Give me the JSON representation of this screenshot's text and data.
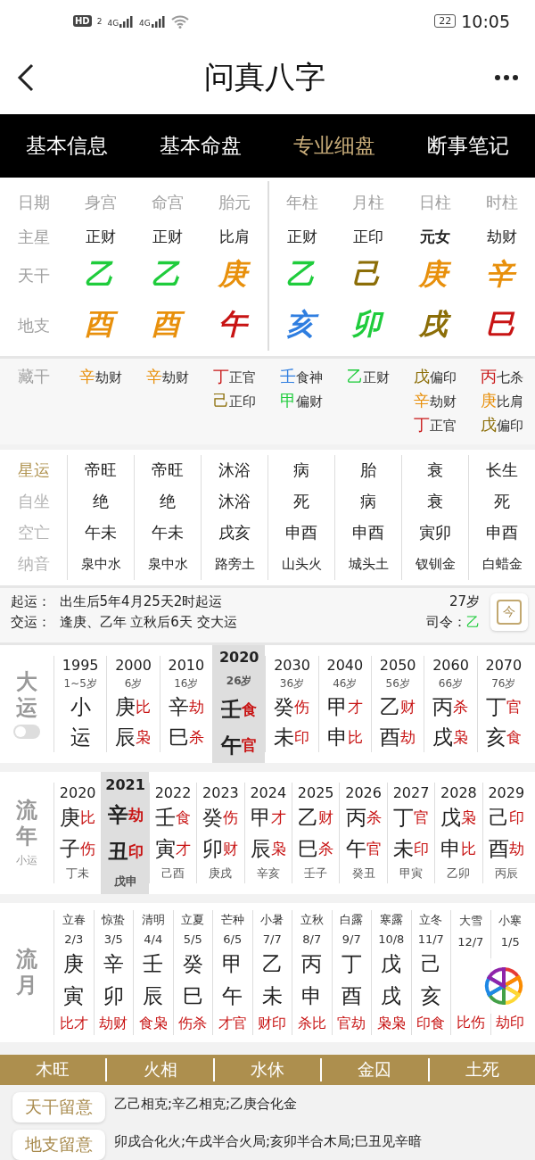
{
  "status_bar": {
    "badge": "HD",
    "sim": "2",
    "networks": [
      "4G",
      "4G"
    ],
    "battery": "22",
    "time": "10:05"
  },
  "header": {
    "title": "问真八字"
  },
  "tabs": [
    {
      "label": "基本信息",
      "selected": false
    },
    {
      "label": "基本命盘",
      "selected": false
    },
    {
      "label": "专业细盘",
      "selected": true
    },
    {
      "label": "断事笔记",
      "selected": false
    }
  ],
  "chart": {
    "row_labels": [
      "日期",
      "主星",
      "天干",
      "地支"
    ],
    "columns": [
      {
        "header": "身宫",
        "star": "正财",
        "star_bold": false,
        "stem": {
          "char": "乙",
          "color": "#1fcc3c"
        },
        "branch": {
          "char": "酉",
          "color": "#e8900c"
        }
      },
      {
        "header": "命宫",
        "star": "正财",
        "star_bold": false,
        "stem": {
          "char": "乙",
          "color": "#1fcc3c"
        },
        "branch": {
          "char": "酉",
          "color": "#e8900c"
        }
      },
      {
        "header": "胎元",
        "star": "比肩",
        "star_bold": false,
        "stem": {
          "char": "庚",
          "color": "#e8900c"
        },
        "branch": {
          "char": "午",
          "color": "#c81414"
        }
      },
      {
        "header": "年柱",
        "star": "正财",
        "star_bold": false,
        "stem": {
          "char": "乙",
          "color": "#1fcc3c"
        },
        "branch": {
          "char": "亥",
          "color": "#2f7ee0"
        }
      },
      {
        "header": "月柱",
        "star": "正印",
        "star_bold": false,
        "stem": {
          "char": "己",
          "color": "#8c6e08"
        },
        "branch": {
          "char": "卯",
          "color": "#1fcc3c"
        }
      },
      {
        "header": "日柱",
        "star": "元女",
        "star_bold": true,
        "stem": {
          "char": "庚",
          "color": "#e8900c"
        },
        "branch": {
          "char": "戌",
          "color": "#8c6e08"
        }
      },
      {
        "header": "时柱",
        "star": "劫财",
        "star_bold": false,
        "stem": {
          "char": "辛",
          "color": "#e8900c"
        },
        "branch": {
          "char": "巳",
          "color": "#c81414"
        }
      }
    ]
  },
  "hidden": {
    "label": "藏干",
    "columns": [
      [
        {
          "stem": "辛",
          "color": "#e8900c",
          "god": "劫财"
        }
      ],
      [
        {
          "stem": "辛",
          "color": "#e8900c",
          "god": "劫财"
        }
      ],
      [
        {
          "stem": "丁",
          "color": "#c81414",
          "god": "正官"
        },
        {
          "stem": "己",
          "color": "#8c6e08",
          "god": "正印"
        }
      ],
      [
        {
          "stem": "壬",
          "color": "#2f7ee0",
          "god": "食神"
        },
        {
          "stem": "甲",
          "color": "#1fcc3c",
          "god": "偏财"
        }
      ],
      [
        {
          "stem": "乙",
          "color": "#1fcc3c",
          "god": "正财"
        }
      ],
      [
        {
          "stem": "戊",
          "color": "#8c6e08",
          "god": "偏印"
        },
        {
          "stem": "辛",
          "color": "#e8900c",
          "god": "劫财"
        },
        {
          "stem": "丁",
          "color": "#c81414",
          "god": "正官"
        }
      ],
      [
        {
          "stem": "丙",
          "color": "#c81414",
          "god": "七杀"
        },
        {
          "stem": "庚",
          "color": "#e8900c",
          "god": "比肩"
        },
        {
          "stem": "戊",
          "color": "#8c6e08",
          "god": "偏印"
        }
      ]
    ]
  },
  "stars": [
    {
      "label": "星运",
      "selected": true,
      "values": [
        "帝旺",
        "帝旺",
        "沐浴",
        "病",
        "胎",
        "衰",
        "长生"
      ]
    },
    {
      "label": "自坐",
      "selected": false,
      "values": [
        "绝",
        "绝",
        "沐浴",
        "死",
        "病",
        "衰",
        "死"
      ]
    },
    {
      "label": "空亡",
      "selected": false,
      "values": [
        "午未",
        "午未",
        "戌亥",
        "申酉",
        "申酉",
        "寅卯",
        "申酉"
      ]
    },
    {
      "label": "纳音",
      "selected": false,
      "values": [
        "泉中水",
        "泉中水",
        "路旁土",
        "山头火",
        "城头土",
        "钗钏金",
        "白蜡金"
      ]
    }
  ],
  "luck_info": {
    "lines": [
      {
        "label": "起运：",
        "text": "出生后5年4月25天2时起运"
      },
      {
        "label": "交运：",
        "text": "逢庚、乙年 立秋后6天 交大运"
      }
    ],
    "age": "27岁",
    "commander_label": "司令：",
    "commander": {
      "char": "乙",
      "color": "#1fcc3c"
    },
    "today_button": "今"
  },
  "dayun": {
    "label": "大运",
    "toggle_on": false,
    "items": [
      {
        "year": "1995",
        "age": "1~5岁",
        "stem": "小",
        "branch": "运",
        "selected": false
      },
      {
        "year": "2000",
        "age": "6岁",
        "stem": "庚",
        "stem_god": "比",
        "branch": "辰",
        "branch_god": "枭",
        "selected": false
      },
      {
        "year": "2010",
        "age": "16岁",
        "stem": "辛",
        "stem_god": "劫",
        "branch": "巳",
        "branch_god": "杀",
        "selected": false
      },
      {
        "year": "2020",
        "age": "26岁",
        "stem": "壬",
        "stem_god": "食",
        "branch": "午",
        "branch_god": "官",
        "selected": true
      },
      {
        "year": "2030",
        "age": "36岁",
        "stem": "癸",
        "stem_god": "伤",
        "branch": "未",
        "branch_god": "印",
        "selected": false
      },
      {
        "year": "2040",
        "age": "46岁",
        "stem": "甲",
        "stem_god": "才",
        "branch": "申",
        "branch_god": "比",
        "selected": false
      },
      {
        "year": "2050",
        "age": "56岁",
        "stem": "乙",
        "stem_god": "财",
        "branch": "酉",
        "branch_god": "劫",
        "selected": false
      },
      {
        "year": "2060",
        "age": "66岁",
        "stem": "丙",
        "stem_god": "杀",
        "branch": "戌",
        "branch_god": "枭",
        "selected": false
      },
      {
        "year": "2070",
        "age": "76岁",
        "stem": "丁",
        "stem_god": "官",
        "branch": "亥",
        "branch_god": "食",
        "selected": false
      }
    ]
  },
  "liunian": {
    "label": "流年",
    "sublabel": "小运",
    "items": [
      {
        "year": "2020",
        "stem": "庚",
        "stem_god": "比",
        "branch": "子",
        "branch_god": "伤",
        "xiaoyun": "丁未",
        "selected": false
      },
      {
        "year": "2021",
        "stem": "辛",
        "stem_god": "劫",
        "branch": "丑",
        "branch_god": "印",
        "xiaoyun": "戊申",
        "selected": true
      },
      {
        "year": "2022",
        "stem": "壬",
        "stem_god": "食",
        "branch": "寅",
        "branch_god": "才",
        "xiaoyun": "己酉",
        "selected": false
      },
      {
        "year": "2023",
        "stem": "癸",
        "stem_god": "伤",
        "branch": "卯",
        "branch_god": "财",
        "xiaoyun": "庚戌",
        "selected": false
      },
      {
        "year": "2024",
        "stem": "甲",
        "stem_god": "才",
        "branch": "辰",
        "branch_god": "枭",
        "xiaoyun": "辛亥",
        "selected": false
      },
      {
        "year": "2025",
        "stem": "乙",
        "stem_god": "财",
        "branch": "巳",
        "branch_god": "杀",
        "xiaoyun": "壬子",
        "selected": false
      },
      {
        "year": "2026",
        "stem": "丙",
        "stem_god": "杀",
        "branch": "午",
        "branch_god": "官",
        "xiaoyun": "癸丑",
        "selected": false
      },
      {
        "year": "2027",
        "stem": "丁",
        "stem_god": "官",
        "branch": "未",
        "branch_god": "印",
        "xiaoyun": "甲寅",
        "selected": false
      },
      {
        "year": "2028",
        "stem": "戊",
        "stem_god": "枭",
        "branch": "申",
        "branch_god": "比",
        "xiaoyun": "乙卯",
        "selected": false
      },
      {
        "year": "2029",
        "stem": "己",
        "stem_god": "印",
        "branch": "酉",
        "branch_god": "劫",
        "xiaoyun": "丙辰",
        "selected": false
      }
    ]
  },
  "liuyue": {
    "label": "流月",
    "items": [
      {
        "term": "立春",
        "date": "2/3",
        "stem": "庚",
        "branch": "寅",
        "gods": "比才"
      },
      {
        "term": "惊蛰",
        "date": "3/5",
        "stem": "辛",
        "branch": "卯",
        "gods": "劫财"
      },
      {
        "term": "清明",
        "date": "4/4",
        "stem": "壬",
        "branch": "辰",
        "gods": "食枭"
      },
      {
        "term": "立夏",
        "date": "5/5",
        "stem": "癸",
        "branch": "巳",
        "gods": "伤杀"
      },
      {
        "term": "芒种",
        "date": "6/5",
        "stem": "甲",
        "branch": "午",
        "gods": "才官"
      },
      {
        "term": "小暑",
        "date": "7/7",
        "stem": "乙",
        "branch": "未",
        "gods": "财印"
      },
      {
        "term": "立秋",
        "date": "8/7",
        "stem": "丙",
        "branch": "申",
        "gods": "杀比"
      },
      {
        "term": "白露",
        "date": "9/7",
        "stem": "丁",
        "branch": "酉",
        "gods": "官劫"
      },
      {
        "term": "寒露",
        "date": "10/8",
        "stem": "戊",
        "branch": "戌",
        "gods": "枭枭"
      },
      {
        "term": "立冬",
        "date": "11/7",
        "stem": "己",
        "branch": "亥",
        "gods": "印食"
      },
      {
        "term": "大雪",
        "date": "12/7",
        "gods": "比伤"
      },
      {
        "term": "小寒",
        "date": "1/5",
        "gods": "劫印"
      }
    ]
  },
  "seasons": [
    "木旺",
    "火相",
    "水休",
    "金囚",
    "土死"
  ],
  "notes": [
    {
      "label": "天干留意",
      "text": "乙己相克;辛乙相克;乙庚合化金"
    },
    {
      "label": "地支留意",
      "text": "卯戌合化火;午戌半合火局;亥卯半合木局;巳丑见辛暗"
    }
  ]
}
